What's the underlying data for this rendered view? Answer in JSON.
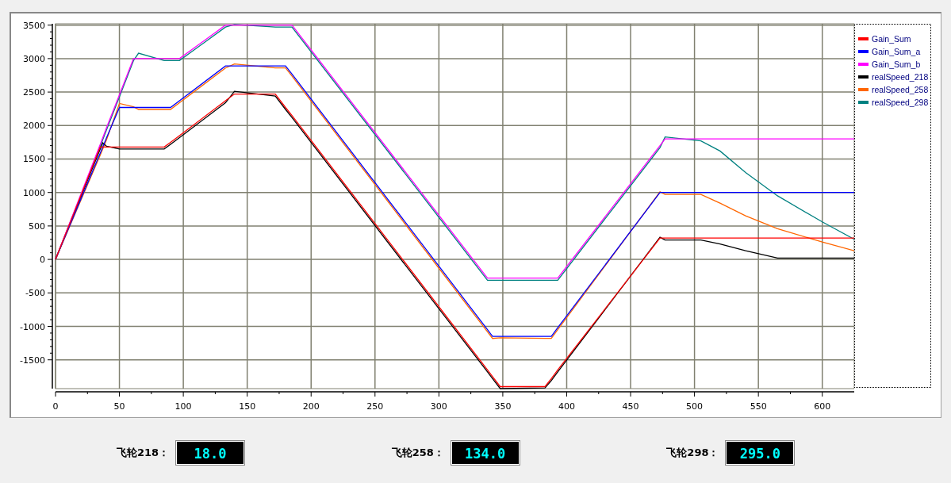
{
  "chart_data": {
    "type": "line",
    "xlim": [
      0,
      625
    ],
    "ylim": [
      -1930,
      3520
    ],
    "xticks": [
      0,
      50,
      100,
      150,
      200,
      250,
      300,
      350,
      400,
      450,
      500,
      550,
      600
    ],
    "yticks": [
      -1500,
      -1000,
      -500,
      0,
      500,
      1000,
      1500,
      2000,
      2500,
      3000,
      3500
    ],
    "grid": true,
    "legend": true,
    "x": [
      0,
      35,
      37,
      40,
      50,
      61,
      65,
      85,
      90,
      97,
      133,
      140,
      172,
      180,
      185,
      338,
      342,
      348,
      383,
      388,
      393,
      473,
      477,
      505,
      520,
      540,
      565,
      600,
      625
    ],
    "series": [
      {
        "name": "Gain_Sum",
        "color": "#ff0000",
        "values": [
          0,
          1680,
          1680,
          1680,
          1680,
          1680,
          1680,
          1680,
          1750,
          1850,
          2370,
          2470,
          2470,
          2270,
          2150,
          -1650,
          -1750,
          -1900,
          -1900,
          -1780,
          -1650,
          320,
          320,
          320,
          320,
          320,
          320,
          320,
          320
        ]
      },
      {
        "name": "Gain_Sum_a",
        "color": "#0000ff",
        "values": [
          0,
          1590,
          1680,
          1820,
          2270,
          2270,
          2270,
          2270,
          2270,
          2370,
          2890,
          2890,
          2890,
          2890,
          2770,
          -1050,
          -1150,
          -1150,
          -1150,
          -1150,
          -1020,
          1000,
          1000,
          1000,
          1000,
          1000,
          1000,
          1000,
          1000
        ]
      },
      {
        "name": "Gain_Sum_b",
        "color": "#ff00ff",
        "values": [
          0,
          1720,
          1820,
          1970,
          2460,
          3000,
          3000,
          3000,
          3000,
          3000,
          3500,
          3500,
          3500,
          3500,
          3500,
          -280,
          -280,
          -280,
          -280,
          -280,
          -280,
          1700,
          1800,
          1800,
          1800,
          1800,
          1800,
          1800,
          1800
        ]
      },
      {
        "name": "realSpeed_218",
        "color": "#000000",
        "values": [
          0,
          1650,
          1740,
          1690,
          1650,
          1650,
          1650,
          1650,
          1720,
          1820,
          2340,
          2510,
          2440,
          2240,
          2120,
          -1680,
          -1780,
          -1930,
          -1920,
          -1810,
          -1680,
          330,
          290,
          290,
          230,
          130,
          20,
          20,
          20
        ]
      },
      {
        "name": "realSpeed_258",
        "color": "#ff6600",
        "values": [
          0,
          1560,
          1650,
          1790,
          2330,
          2280,
          2240,
          2240,
          2240,
          2340,
          2860,
          2920,
          2860,
          2860,
          2740,
          -1080,
          -1180,
          -1170,
          -1180,
          -1180,
          -1050,
          1010,
          970,
          970,
          840,
          650,
          460,
          260,
          130
        ]
      },
      {
        "name": "realSpeed_298",
        "color": "#008080",
        "values": [
          0,
          1690,
          1790,
          1940,
          2430,
          2970,
          3080,
          2970,
          2970,
          2970,
          3470,
          3510,
          3470,
          3470,
          3470,
          -310,
          -310,
          -310,
          -310,
          -310,
          -310,
          1670,
          1830,
          1770,
          1620,
          1300,
          950,
          560,
          300
        ]
      }
    ]
  },
  "readouts": [
    {
      "label": "飞轮218：",
      "value": "18.0"
    },
    {
      "label": "飞轮258：",
      "value": "134.0"
    },
    {
      "label": "飞轮298：",
      "value": "295.0"
    }
  ]
}
